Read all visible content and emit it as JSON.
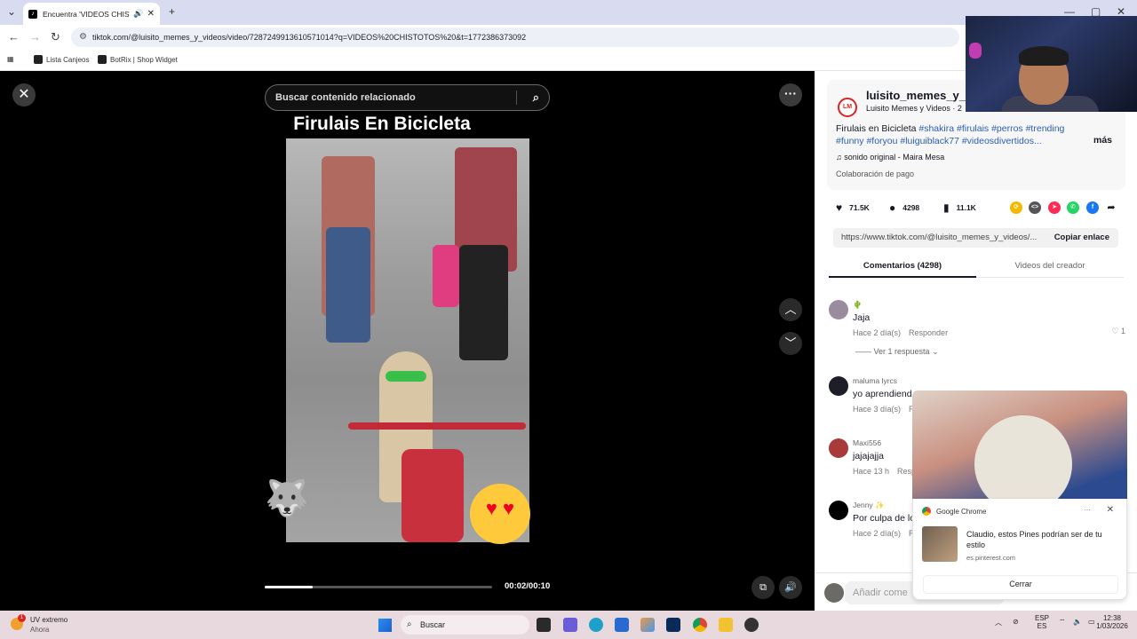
{
  "browser": {
    "tab_title": "Encuentra 'VIDEOS CHISTO",
    "url": "tiktok.com/@luisito_memes_y_videos/video/7287249913610571014?q=VIDEOS%20CHISTOTOS%20&t=1772386373092",
    "bookmarks": [
      "Lista Canjeos",
      "BotRix | Shop Widget"
    ]
  },
  "player": {
    "search_placeholder": "Buscar contenido relacionado",
    "video_title": "Firulais En Bicicleta",
    "time": "00:02/00:10",
    "progress": 0.21
  },
  "side": {
    "author": "luisito_memes_y_vid",
    "author_sub": "Luisito Memes y Videos · 2",
    "caption_text": "Firulais en Bicicleta ",
    "caption_tags": "#shakira #firulais #perros #trending #funny #foryou #luiguiblack77 #videosdivertidos...",
    "more": "más",
    "sound": "sonido original - Maira Mesa",
    "paid": "Colaboración de pago",
    "likes": "71.5K",
    "comments_count": "4298",
    "saves": "11.1K",
    "link_url": "https://www.tiktok.com/@luisito_memes_y_videos/...",
    "copy_link": "Copiar enlace",
    "tab_comments": "Comentarios (4298)",
    "tab_creator": "Videos del creador",
    "view_replies": "Ver 1 respuesta",
    "add_comment": "Añadir come"
  },
  "comments": [
    {
      "user": "🌵",
      "text": "Jaja",
      "time": "Hace 2 día(s)",
      "reply": "Responder",
      "likes": "1"
    },
    {
      "user": "maluma lyrcs",
      "text": "yo aprendiend",
      "time": "Hace 3 día(s)",
      "reply": "R"
    },
    {
      "user": "Maxi556",
      "text": "jajajajja",
      "time": "Hace 13 h",
      "reply": "Resp"
    },
    {
      "user": "Jenny ✨",
      "text": "Por culpa de lo",
      "time": "Hace 2 día(s)",
      "reply": "R"
    }
  ],
  "notification": {
    "app": "Google Chrome",
    "body": "Claudio, estos Pines podrían ser de tu estilo",
    "site": "es.pinterest.com",
    "close": "Cerrar"
  },
  "taskbar": {
    "weather_title": "UV extremo",
    "weather_sub": "Ahora",
    "weather_badge": "1",
    "search": "Buscar",
    "lang1": "ESP",
    "lang2": "ES",
    "time": "12:38",
    "date": "1/03/2026"
  }
}
